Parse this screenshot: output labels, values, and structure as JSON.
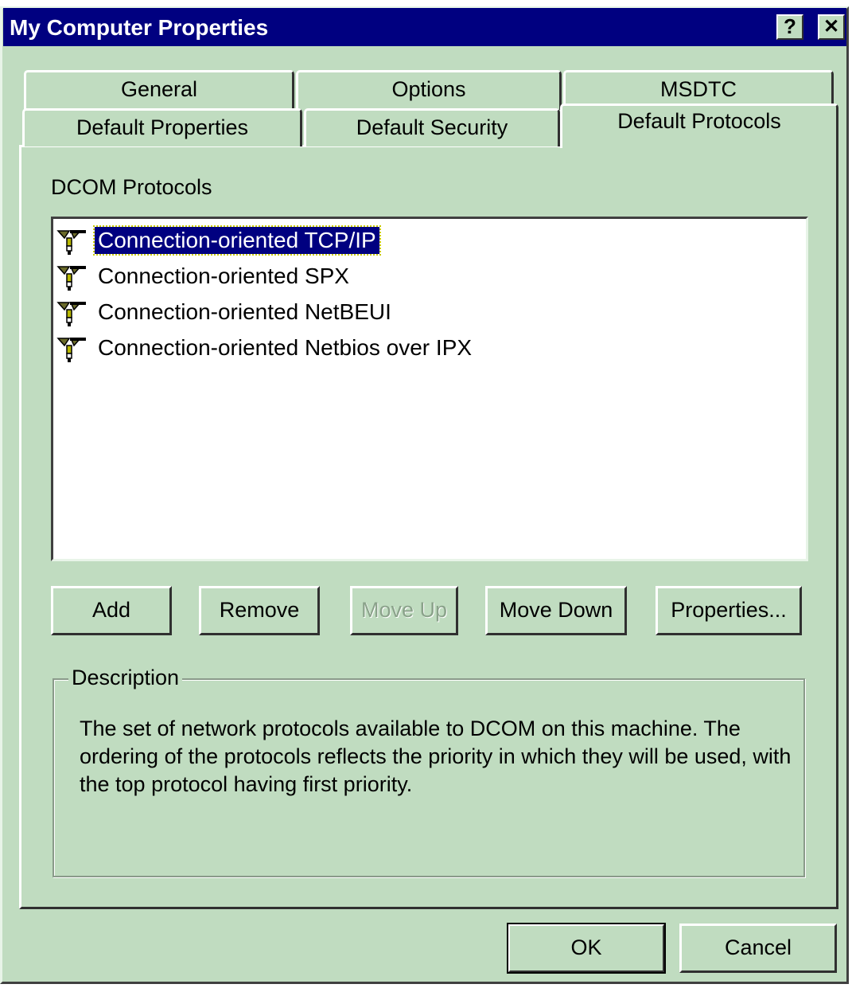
{
  "window": {
    "title": "My Computer Properties",
    "help_button": "?",
    "close_button": "✕"
  },
  "tabs_row1": [
    {
      "label": "General"
    },
    {
      "label": "Options"
    },
    {
      "label": "MSDTC"
    }
  ],
  "tabs_row2": [
    {
      "label": "Default Properties"
    },
    {
      "label": "Default Security"
    },
    {
      "label": "Default Protocols",
      "active": true
    }
  ],
  "panel": {
    "list_label": "DCOM Protocols",
    "protocols": [
      {
        "label": "Connection-oriented TCP/IP",
        "icon": "network-protocol-icon",
        "selected": true
      },
      {
        "label": "Connection-oriented SPX",
        "icon": "network-protocol-icon"
      },
      {
        "label": "Connection-oriented NetBEUI",
        "icon": "network-protocol-icon"
      },
      {
        "label": "Connection-oriented Netbios over IPX",
        "icon": "network-protocol-icon"
      }
    ],
    "buttons": {
      "add": "Add",
      "remove": "Remove",
      "move_up": "Move Up",
      "move_down": "Move Down",
      "properties": "Properties..."
    },
    "description": {
      "legend": "Description",
      "text": "The set of network protocols available to DCOM on this machine. The ordering of the protocols reflects the priority in which they will be used, with the top protocol having first priority."
    }
  },
  "footer": {
    "ok": "OK",
    "cancel": "Cancel"
  },
  "colors": {
    "face": "#c0dcc0",
    "titlebar": "#000080",
    "selection": "#000080"
  }
}
